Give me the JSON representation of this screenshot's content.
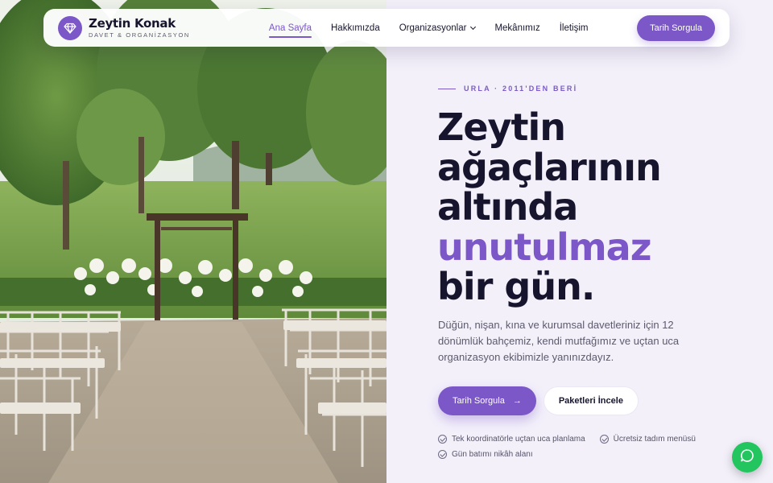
{
  "navbar": {
    "brand_name": "Zeytin Konak",
    "brand_tagline": "DAVET & ORGANİZASYON",
    "logo_icon": "diamond-icon",
    "links": [
      {
        "label": "Ana Sayfa",
        "active": true
      },
      {
        "label": "Hakkımızda",
        "active": false
      },
      {
        "label": "Organizasyonlar",
        "active": false,
        "has_dropdown": true
      },
      {
        "label": "Mekânımız",
        "active": false
      },
      {
        "label": "İletişim",
        "active": false
      }
    ],
    "cta_label": "Tarih Sorgula"
  },
  "hero": {
    "eyebrow": "URLA · 2011'DEN BERİ",
    "headline_lines": [
      "Zeytin",
      "ağaçlarının",
      "altında"
    ],
    "headline_accent": "unutulmaz",
    "headline_end": "bir gün.",
    "lead": "Düğün, nişan, kına ve kurumsal davetleriniz için 12 dönümlük bahçemiz, kendi mutfağımız ve uçtan uca organizasyon ekibimizle yanınızdayız.",
    "primary_cta": "Tarih Sorgula",
    "primary_cta_icon": "arrow-right-icon",
    "secondary_cta": "Paketleri İncele",
    "features": [
      "Tek koordinatörle uçtan uca planlama",
      "Ücretsiz tadım menüsü",
      "Gün batımı nikâh alanı"
    ]
  },
  "chat": {
    "icon": "chat-bubble-icon"
  },
  "colors": {
    "accent": "#7b57c8",
    "dark": "#17152e",
    "panel_bg": "#f3f0fa",
    "chat_green": "#22c55e"
  }
}
